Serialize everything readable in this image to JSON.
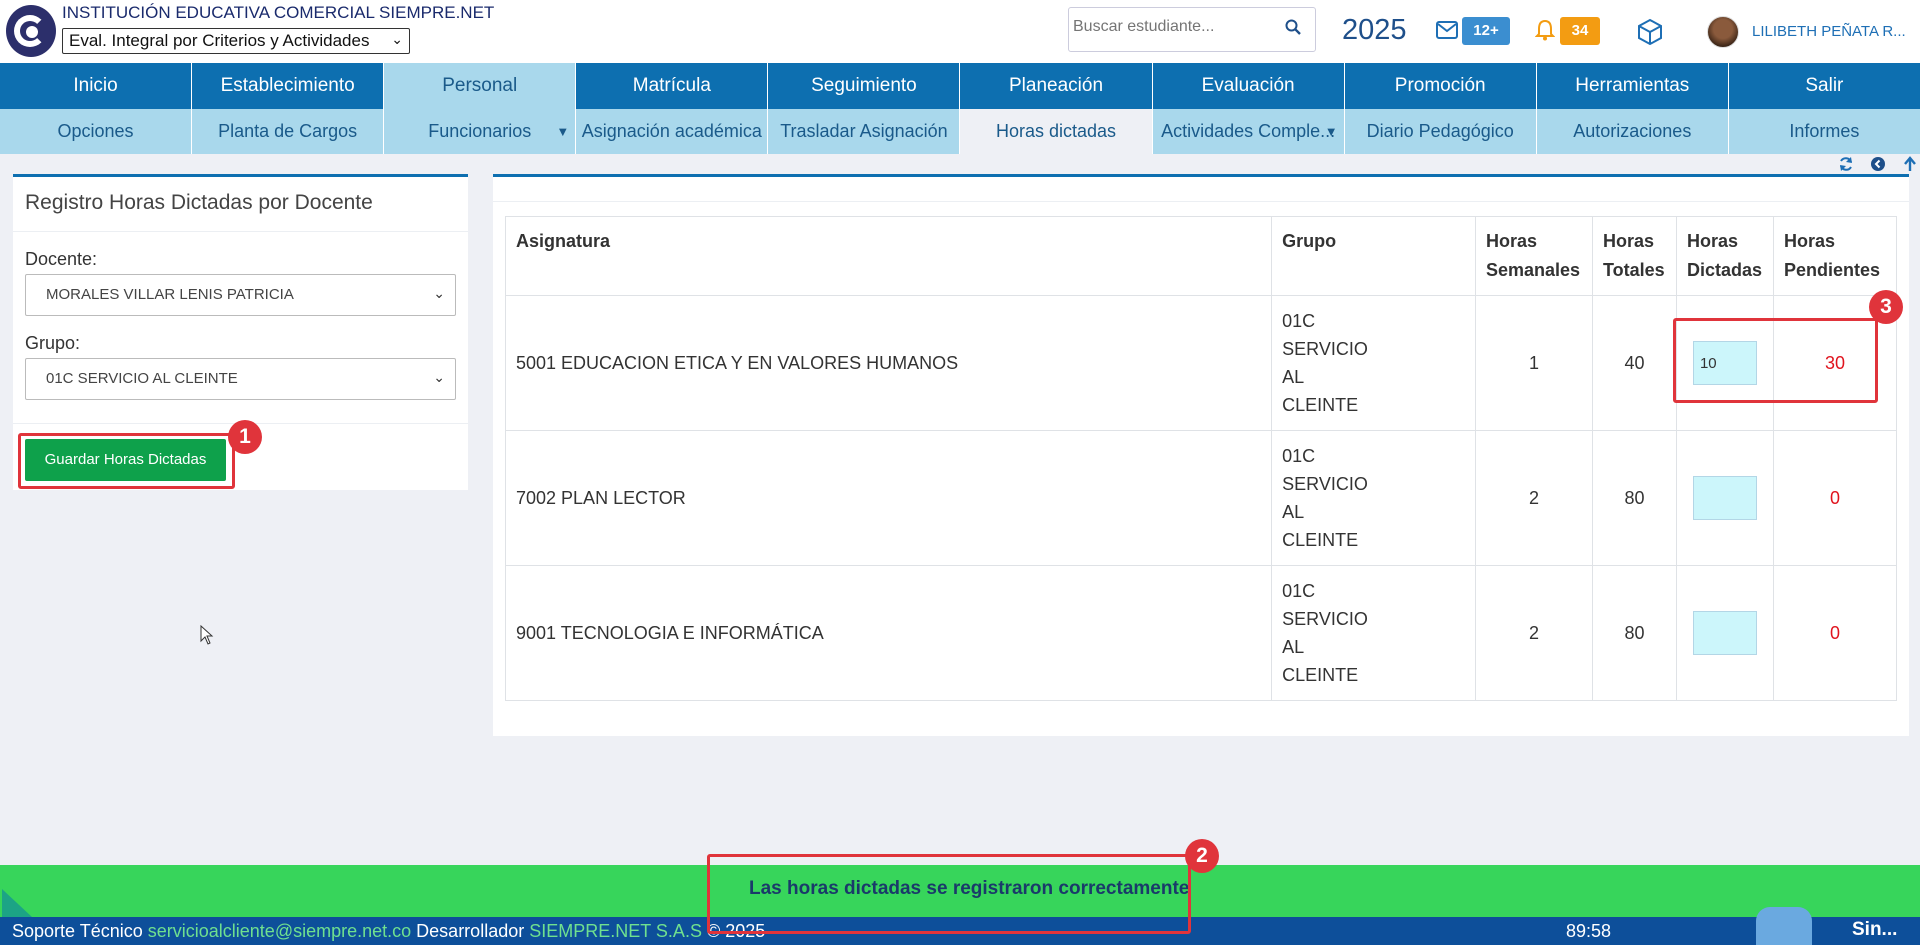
{
  "header": {
    "institution": "INSTITUCIÓN EDUCATIVA COMERCIAL SIEMPRE.NET",
    "eval_mode": "Eval. Integral por Criterios y Actividades",
    "search_placeholder": "Buscar estudiante...",
    "year": "2025",
    "mail_badge": "12+",
    "notif_badge": "34",
    "user_name": "LILIBETH PEÑATA R..."
  },
  "main_nav": [
    "Inicio",
    "Establecimiento",
    "Personal",
    "Matrícula",
    "Seguimiento",
    "Planeación",
    "Evaluación",
    "Promoción",
    "Herramientas",
    "Salir"
  ],
  "sub_nav": [
    "Opciones",
    "Planta de Cargos",
    "Funcionarios",
    "Asignación académica",
    "Trasladar Asignación",
    "Horas dictadas",
    "Actividades Comple...",
    "Diario Pedagógico",
    "Autorizaciones",
    "Informes"
  ],
  "form": {
    "title": "Registro Horas Dictadas por Docente",
    "docente_label": "Docente:",
    "docente_value": "MORALES VILLAR LENIS PATRICIA",
    "grupo_label": "Grupo:",
    "grupo_value": "01C SERVICIO AL CLEINTE",
    "save_label": "Guardar Horas Dictadas"
  },
  "table": {
    "headers": {
      "asignatura": "Asignatura",
      "grupo": "Grupo",
      "semanales_1": "Horas",
      "semanales_2": "Semanales",
      "totales_1": "Horas",
      "totales_2": "Totales",
      "dictadas_1": "Horas",
      "dictadas_2": "Dictadas",
      "pendientes_1": "Horas",
      "pendientes_2": "Pendientes"
    },
    "rows": [
      {
        "asignatura": "5001 EDUCACION ETICA Y EN VALORES HUMANOS",
        "grupo_1": "01C",
        "grupo_2": "SERVICIO",
        "grupo_3": "AL",
        "grupo_4": "CLEINTE",
        "semanales": "1",
        "totales": "40",
        "dictadas": "10",
        "pendientes": "30"
      },
      {
        "asignatura": "7002 PLAN LECTOR",
        "grupo_1": "01C",
        "grupo_2": "SERVICIO",
        "grupo_3": "AL",
        "grupo_4": "CLEINTE",
        "semanales": "2",
        "totales": "80",
        "dictadas": "",
        "pendientes": "0"
      },
      {
        "asignatura": "9001 TECNOLOGIA E INFORMÁTICA",
        "grupo_1": "01C",
        "grupo_2": "SERVICIO",
        "grupo_3": "AL",
        "grupo_4": "CLEINTE",
        "semanales": "2",
        "totales": "80",
        "dictadas": "",
        "pendientes": "0"
      }
    ]
  },
  "annotations": [
    "1",
    "2",
    "3"
  ],
  "toast": "Las horas dictadas se registraron correctamente",
  "footer": {
    "support_label": "Soporte Técnico",
    "support_email": "servicioalcliente@siempre.net.co",
    "dev_label": "Desarrollador",
    "dev_name": "SIEMPRE.NET S.A.S",
    "copyright": "© 2025",
    "timer": "89:58",
    "brand": "Sin..."
  },
  "colors": {
    "nav": "#0d6fb0",
    "subnav": "#a9d8ec",
    "save_button": "#0ea14b",
    "toast": "#37d55b",
    "footer": "#0d4f9a",
    "annotation": "#e0343b",
    "pending_text": "#e0141e",
    "input_bg": "#ccf6fb"
  },
  "icons": [
    "logo",
    "search-icon",
    "mail-icon",
    "bell-icon",
    "cube-icon",
    "refresh-icon",
    "back-icon",
    "up-arrow-icon",
    "info-icon"
  ]
}
